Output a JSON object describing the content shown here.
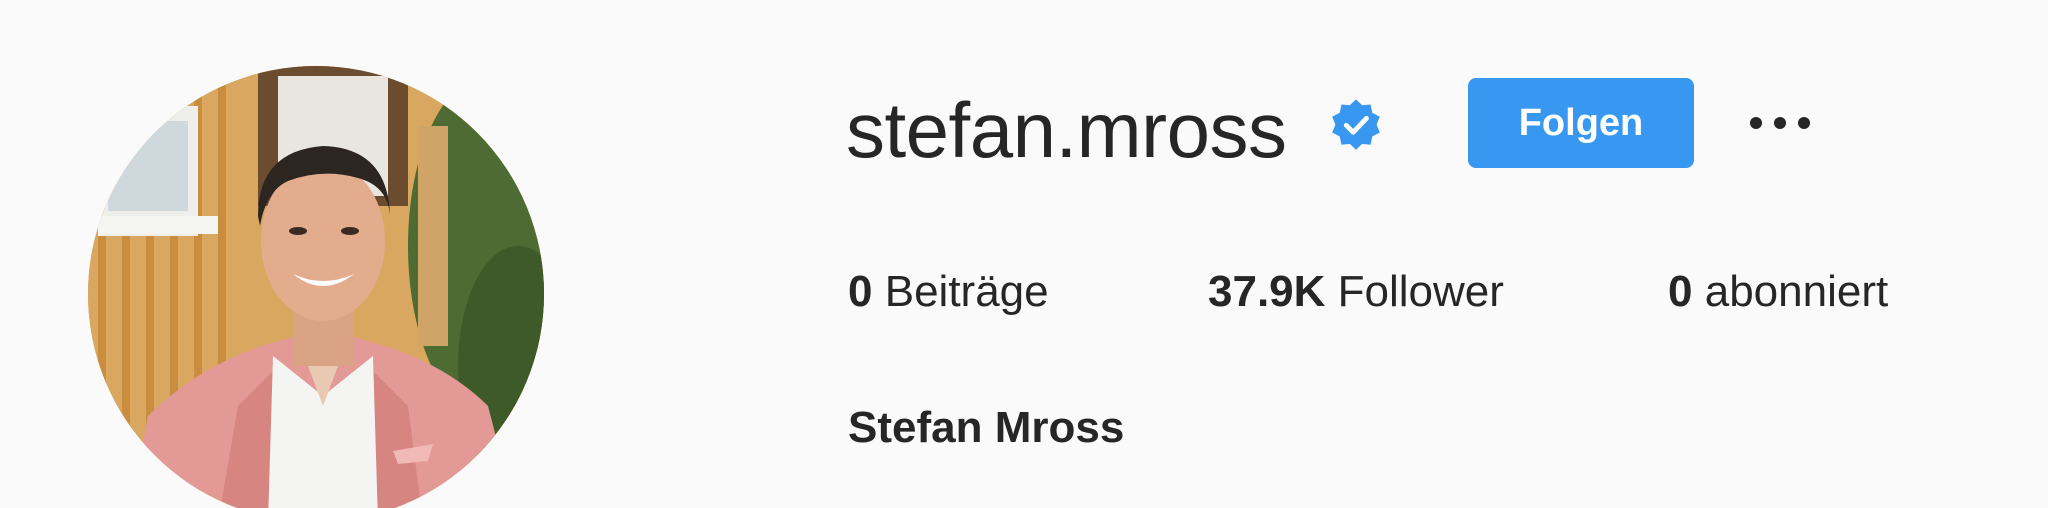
{
  "profile": {
    "username": "stefan.mross",
    "full_name": "Stefan Mross",
    "verified": true
  },
  "actions": {
    "follow_label": "Folgen",
    "more_icon": "more-horizontal-icon"
  },
  "stats": {
    "posts": {
      "count": "0",
      "label": "Beiträge"
    },
    "followers": {
      "count": "37.9K",
      "label": "Follower"
    },
    "following": {
      "count": "0",
      "label": "abonniert"
    }
  },
  "icons": {
    "verified": "verified-badge-icon"
  },
  "colors": {
    "follow_button": "#3897f0",
    "verified_badge": "#3897f0",
    "text": "#262626",
    "background": "#fafafa"
  }
}
